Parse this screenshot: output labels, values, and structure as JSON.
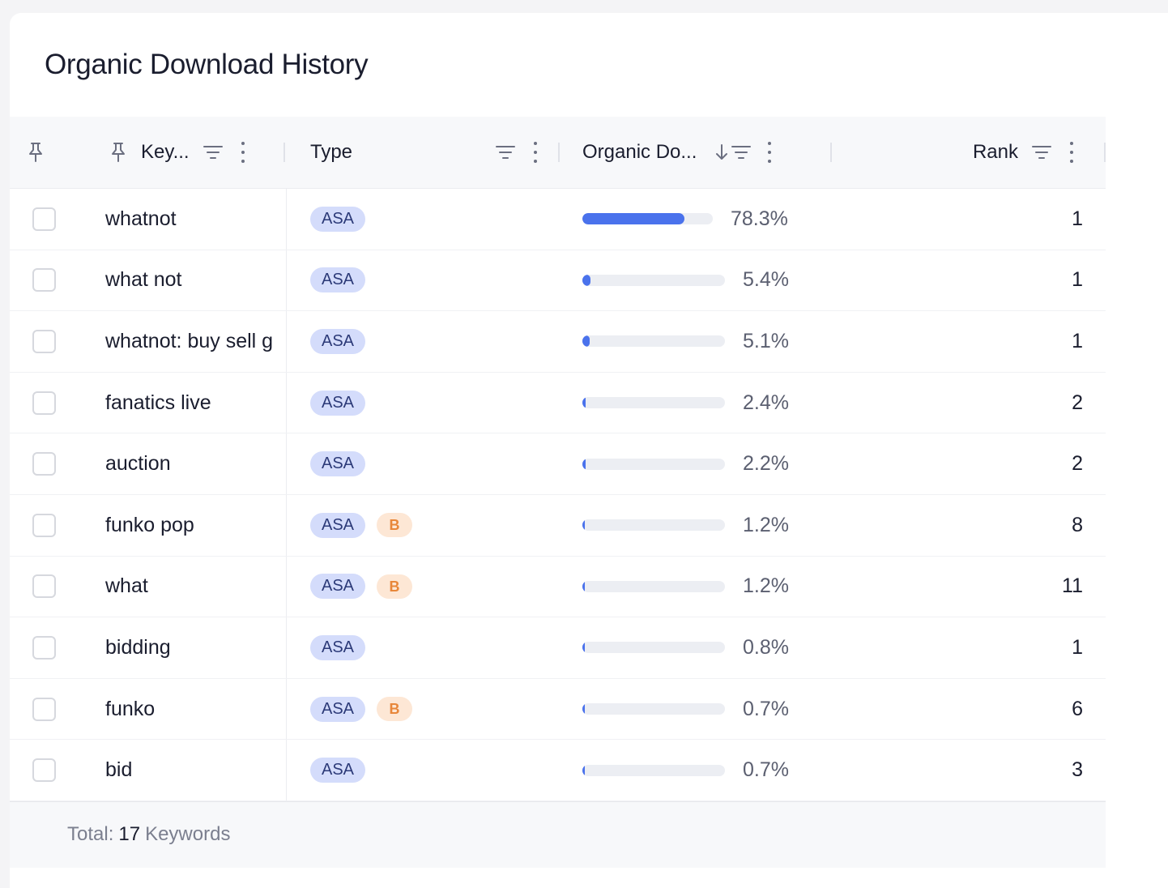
{
  "title": "Organic Download History",
  "columns": {
    "keyword": "Key...",
    "type": "Type",
    "organic": "Organic Do...",
    "rank": "Rank"
  },
  "rows": [
    {
      "keyword": "whatnot",
      "badges": [
        "ASA"
      ],
      "pct": "78.3%",
      "fill": 0.783,
      "rank": "1"
    },
    {
      "keyword": "what not",
      "badges": [
        "ASA"
      ],
      "pct": "5.4%",
      "fill": 0.054,
      "rank": "1"
    },
    {
      "keyword": "whatnot: buy sell g",
      "badges": [
        "ASA"
      ],
      "pct": "5.1%",
      "fill": 0.051,
      "rank": "1"
    },
    {
      "keyword": "fanatics live",
      "badges": [
        "ASA"
      ],
      "pct": "2.4%",
      "fill": 0.024,
      "rank": "2"
    },
    {
      "keyword": "auction",
      "badges": [
        "ASA"
      ],
      "pct": "2.2%",
      "fill": 0.022,
      "rank": "2"
    },
    {
      "keyword": "funko pop",
      "badges": [
        "ASA",
        "B"
      ],
      "pct": "1.2%",
      "fill": 0.012,
      "rank": "8"
    },
    {
      "keyword": "what",
      "badges": [
        "ASA",
        "B"
      ],
      "pct": "1.2%",
      "fill": 0.012,
      "rank": "11"
    },
    {
      "keyword": "bidding",
      "badges": [
        "ASA"
      ],
      "pct": "0.8%",
      "fill": 0.008,
      "rank": "1"
    },
    {
      "keyword": "funko",
      "badges": [
        "ASA",
        "B"
      ],
      "pct": "0.7%",
      "fill": 0.007,
      "rank": "6"
    },
    {
      "keyword": "bid",
      "badges": [
        "ASA"
      ],
      "pct": "0.7%",
      "fill": 0.007,
      "rank": "3"
    }
  ],
  "footer": {
    "prefix": "Total:",
    "count": "17",
    "suffix": "Keywords"
  },
  "colors": {
    "accent": "#4a72ec",
    "asa_badge_bg": "#d4dcfb",
    "b_badge_bg": "#fde7d5",
    "b_badge_text": "#e8873a"
  }
}
